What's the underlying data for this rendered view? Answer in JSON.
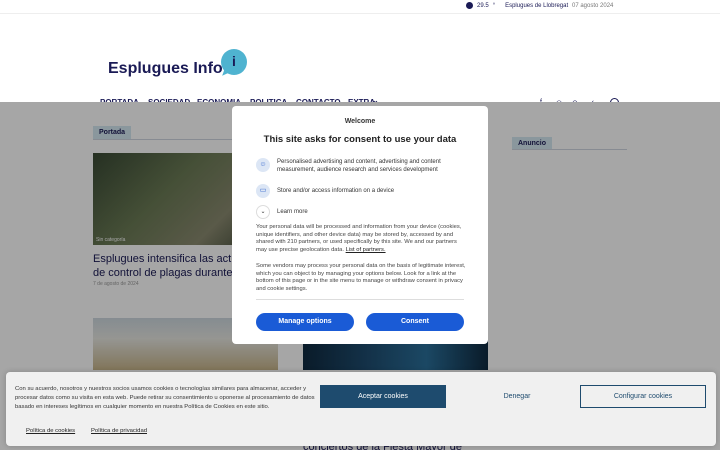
{
  "topbar": {
    "temperature": "29.5",
    "unit": "°",
    "location": "Esplugues de Llobregat",
    "date": "07 agosto 2024"
  },
  "header": {
    "logo_text": "Esplugues Info",
    "logo_badge": "i"
  },
  "nav": {
    "items": [
      "PORTADA",
      "SOCIEDAD",
      "ECONOMIA",
      "POLITICA",
      "CONTACTO",
      "EXTRA"
    ],
    "extra_chevron": "⌄"
  },
  "social": {
    "icons": [
      "f",
      "◎",
      "⊙",
      "✓"
    ]
  },
  "content": {
    "section_tag": "Portada",
    "right_tag": "Anuncio",
    "article1": {
      "category": "Sin categoría",
      "title": "Esplugues intensifica las actu… de control de plagas durante e…",
      "date": "7 de agosto de 2024"
    },
    "article2": {
      "title": "conciertos de la Fiesta Mayor de Sant…"
    }
  },
  "modal": {
    "welcome": "Welcome",
    "title": "This site asks for consent to use your data",
    "purposes": [
      "Personalised advertising and content, advertising and content measurement, audience research and services development",
      "Store and/or access information on a device"
    ],
    "learn_more": "Learn more",
    "para1": "Your personal data will be processed and information from your device (cookies, unique identifiers, and other device data) may be stored by, accessed by and shared with 210 partners, or used specifically by this site. We and our partners may use precise geolocation data.",
    "para1_link": "List of partners.",
    "para2": "Some vendors may process your personal data on the basis of legitimate interest, which you can object to by managing your options below. Look for a link at the bottom of this page or in the site menu to manage or withdraw consent in privacy and cookie settings.",
    "manage_label": "Manage options",
    "consent_label": "Consent"
  },
  "cookie": {
    "text": "Con su acuerdo, nosotros y nuestros socios usamos cookies o tecnologías similares para almacenar, acceder y procesar datos como su visita en esta web. Puede retirar su consentimiento u oponerse al procesamiento de datos basado en intereses legítimos en cualquier momento en nuestra Política de Cookies en este sitio.",
    "accept_label": "Aceptar cookies",
    "deny_label": "Denegar",
    "config_label": "Configurar cookies",
    "link_cookies": "Política de cookies",
    "link_privacy": "Política de privacidad"
  }
}
